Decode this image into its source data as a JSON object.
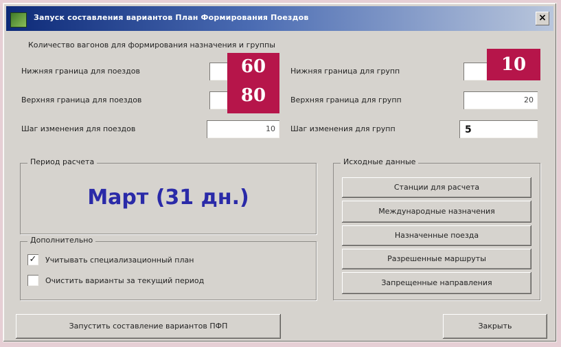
{
  "window": {
    "title": "Запуск составления вариантов План Формирования Поездов",
    "close_glyph": "×"
  },
  "counts_caption": "Количество вагонов для формирования назначения и группы",
  "trains": {
    "lower_label": "Нижняя граница для поездов",
    "lower_value": "60",
    "upper_label": "Верхняя граница для поездов",
    "upper_value": "80",
    "step_label": "Шаг изменения для поездов",
    "step_value": "10"
  },
  "groups": {
    "lower_label": "Нижняя граница для групп",
    "lower_value": "10",
    "upper_label": "Верхняя граница для групп",
    "upper_value": "20",
    "step_label": "Шаг изменения для групп",
    "step_value": "5"
  },
  "period": {
    "title": "Период расчета",
    "month": "Март (31 дн.)"
  },
  "extra": {
    "title": "Дополнительно",
    "checkbox_1_label": "Учитывать специализационный план",
    "checkbox_1_checked": true,
    "checkbox_2_label": "Очистить варианты за текущий период",
    "checkbox_2_checked": false
  },
  "source": {
    "title": "Исходные данные",
    "buttons": [
      "Станции для расчета",
      "Международные назначения",
      "Назначенные поезда",
      "Разрешенные маршруты",
      "Запрещенные направления"
    ]
  },
  "footer": {
    "start_label": "Запустить составление вариантов ПФП",
    "close_label": "Закрыть"
  },
  "colors": {
    "accent_badge": "#b6154a",
    "month_text": "#2a2aa8",
    "title_start": "#0d2a78"
  }
}
